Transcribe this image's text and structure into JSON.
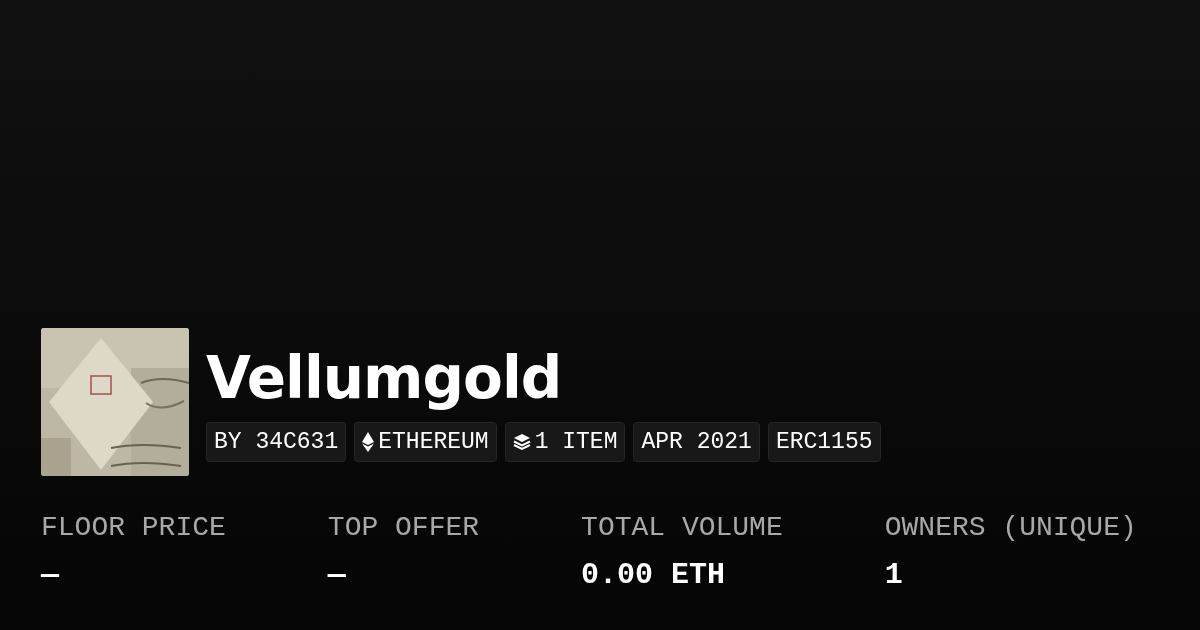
{
  "collection": {
    "title": "Vellumgold",
    "tags": [
      {
        "kind": "text",
        "label": "BY 34C631"
      },
      {
        "kind": "ethereum",
        "label": "ETHEREUM"
      },
      {
        "kind": "layers",
        "label": "1 ITEM"
      },
      {
        "kind": "text",
        "label": "APR 2021"
      },
      {
        "kind": "text",
        "label": "ERC1155"
      }
    ]
  },
  "stats": [
    {
      "label": "FLOOR PRICE",
      "value": "—"
    },
    {
      "label": "TOP OFFER",
      "value": "—"
    },
    {
      "label": "TOTAL VOLUME",
      "value": "0.00 ETH"
    },
    {
      "label": "OWNERS (UNIQUE)",
      "value": "1"
    }
  ]
}
